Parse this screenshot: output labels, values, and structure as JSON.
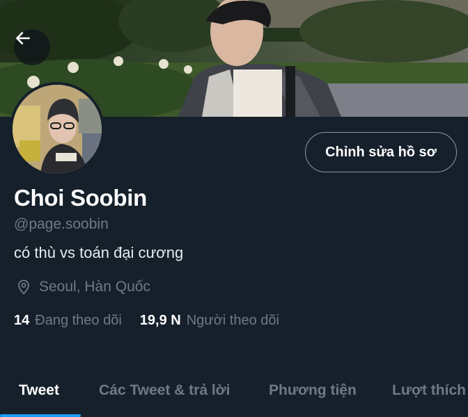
{
  "header": {
    "back_icon": "arrow-left-icon"
  },
  "profile": {
    "edit_label": "Chỉnh sửa hồ sơ",
    "name": "Choi Soobin",
    "handle": "@page.soobin",
    "bio": "có thù vs toán đại cương",
    "location_icon": "location-pin-icon",
    "location": "Seoul, Hàn Quốc",
    "following_count": "14",
    "following_label": "Đang theo dõi",
    "followers_count": "19,9 N",
    "followers_label": "Người theo dõi"
  },
  "tabs": [
    {
      "label": "Tweet",
      "active": true
    },
    {
      "label": "Các Tweet & trả lời",
      "active": false
    },
    {
      "label": "Phương tiện",
      "active": false
    },
    {
      "label": "Lượt thích",
      "active": false
    }
  ],
  "colors": {
    "background": "#15202b",
    "accent": "#1d9bf0",
    "secondary_text": "#6e7a86",
    "border": "#8b98a5"
  }
}
